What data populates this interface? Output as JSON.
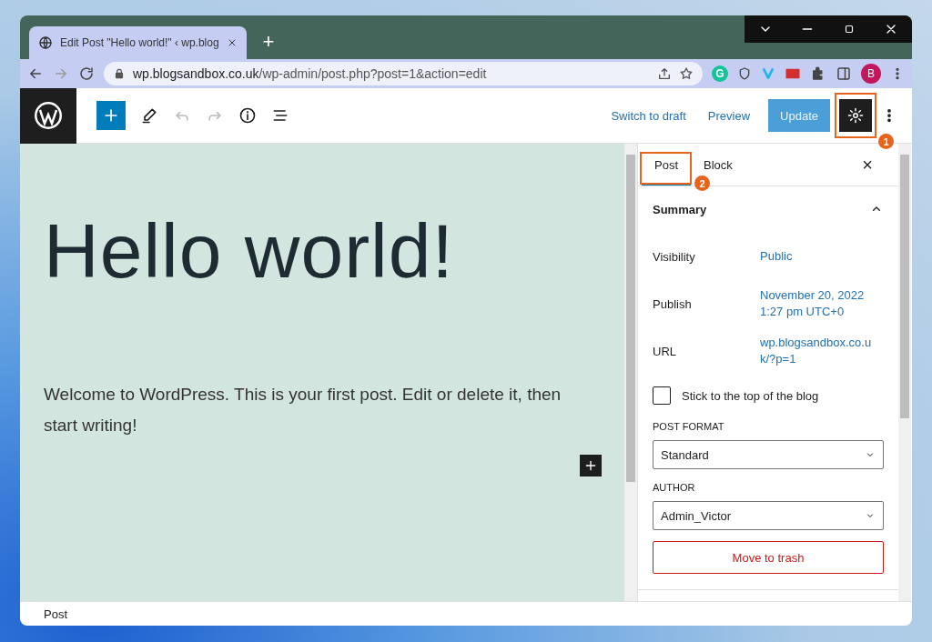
{
  "browser": {
    "tab_title": "Edit Post \"Hello world!\" ‹ wp.blog",
    "new_tab": "+",
    "url_host": "wp.blogsandbox.co.uk",
    "url_path": "/wp-admin/post.php?post=1&action=edit",
    "profile": "B",
    "extension_letter": "G"
  },
  "toolbar": {
    "tools": [
      {
        "kind": "plus",
        "disabled": false
      },
      {
        "kind": "pen",
        "disabled": false
      },
      {
        "kind": "undo",
        "disabled": true
      },
      {
        "kind": "redo",
        "disabled": true
      },
      {
        "kind": "info",
        "disabled": false
      },
      {
        "kind": "list",
        "disabled": false
      }
    ],
    "switch_to_draft": "Switch to draft",
    "preview": "Preview",
    "update": "Update",
    "settings_selected": true
  },
  "post": {
    "title": "Hello world!",
    "body": "Welcome to WordPress. This is your first post. Edit or delete it, then start writing!"
  },
  "sidebar": {
    "tabs": [
      {
        "label": "Post",
        "selected": true
      },
      {
        "label": "Block",
        "selected": false
      }
    ],
    "close": "×",
    "summary": {
      "title": "Summary",
      "expanded": true,
      "rows": [
        {
          "label": "Visibility",
          "value": "Public"
        },
        {
          "label": "Publish",
          "value": "November 20, 2022 1:27 pm UTC+0"
        },
        {
          "label": "URL",
          "value": "wp.blogsandbox.co.u k/?p=1"
        }
      ],
      "sticky": {
        "label": "Stick to the top of the blog",
        "checked": false
      },
      "post_format": {
        "label": "POST FORMAT",
        "value": "Standard"
      },
      "author": {
        "label": "AUTHOR",
        "value": "Admin_Victor"
      },
      "trash": "Move to trash"
    }
  },
  "status_bar": "Post",
  "annotations": [
    {
      "number": "1"
    },
    {
      "number": "2"
    }
  ]
}
